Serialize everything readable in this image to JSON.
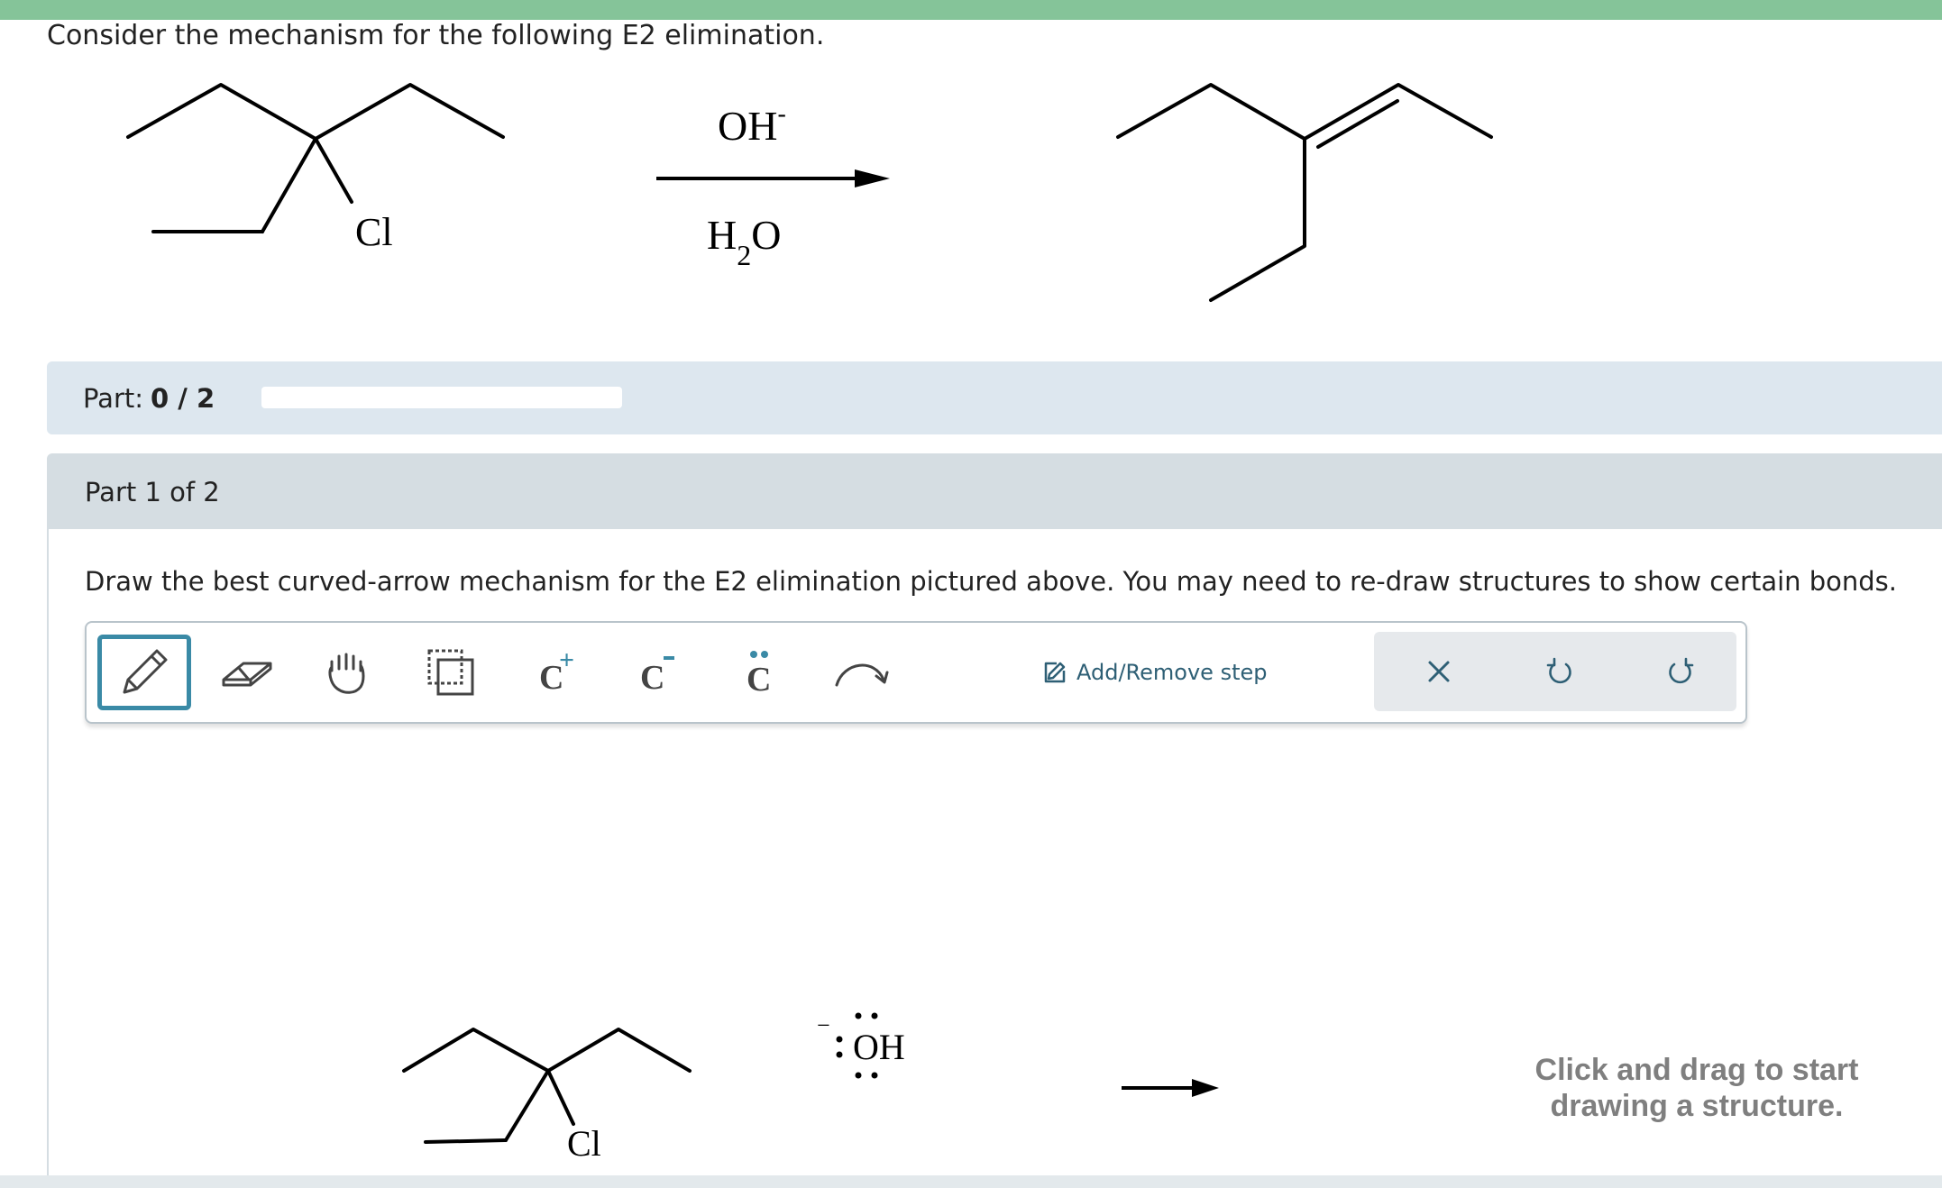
{
  "question": {
    "prompt": "Consider the mechanism for the following E2 elimination.",
    "reaction": {
      "reagent_top": "OH",
      "reagent_top_charge": "-",
      "reagent_bottom": "H",
      "reagent_bottom_subscript": "2",
      "reagent_bottom_tail": "O",
      "reactant_atom_label": "Cl"
    }
  },
  "progress": {
    "label": "Part:",
    "value": "0 / 2",
    "fraction": 0
  },
  "part": {
    "header": "Part 1 of 2",
    "instruction": "Draw the best curved-arrow mechanism for the E2 elimination pictured above. You may need to re-draw structures to show certain bonds."
  },
  "toolbar": {
    "tools": [
      {
        "name": "pencil-tool",
        "icon": "pencil-icon",
        "active": true
      },
      {
        "name": "eraser-tool",
        "icon": "eraser-icon",
        "active": false
      },
      {
        "name": "pan-tool",
        "icon": "hand-icon",
        "active": false
      },
      {
        "name": "select-tool",
        "icon": "select-box-icon",
        "active": false
      },
      {
        "name": "carbocation-tool",
        "icon": "carbocation-icon",
        "glyph": "C",
        "mark": "+",
        "active": false
      },
      {
        "name": "carbanion-tool",
        "icon": "carbanion-icon",
        "glyph": "C",
        "mark": "−",
        "active": false
      },
      {
        "name": "lone-pair-tool",
        "icon": "lone-pair-icon",
        "glyph": "C",
        "active": false
      },
      {
        "name": "curved-arrow-tool",
        "icon": "curved-arrow-icon",
        "active": false
      }
    ],
    "step_label": "Add/Remove step",
    "right_tools": [
      "clear-icon",
      "undo-icon",
      "redo-icon"
    ]
  },
  "canvas": {
    "reactant_atom_label": "Cl",
    "nucleophile_label": "OH",
    "nucleophile_charge": "−",
    "hint_line1": "Click and drag to start",
    "hint_line2": "drawing a structure."
  },
  "colors": {
    "top_bar": "#85c499",
    "accent": "#3a8aa6",
    "part_bar": "#dde7ef",
    "part_header": "#d5dde2"
  }
}
